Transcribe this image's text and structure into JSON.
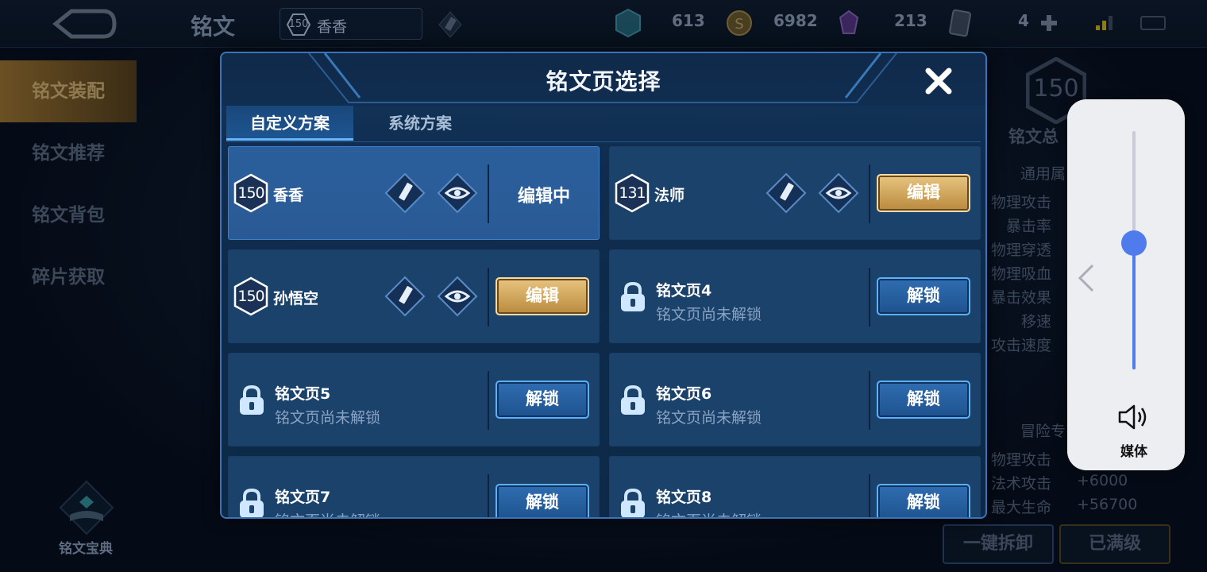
{
  "topbar": {
    "title": "铭文",
    "current_preset": {
      "level": "150",
      "name": "香香"
    },
    "resources": [
      {
        "icon": "blue-gem-icon",
        "value": "613"
      },
      {
        "icon": "gold-coin-icon",
        "value": "6982"
      },
      {
        "icon": "purple-crystal-icon",
        "value": "213"
      },
      {
        "icon": "card-icon",
        "value": "4"
      }
    ]
  },
  "sidebar": {
    "items": [
      "铭文装配",
      "铭文推荐",
      "铭文背包",
      "碎片获取"
    ],
    "active_index": 0,
    "codex_label": "铭文宝典"
  },
  "right_panel": {
    "total_level": "150",
    "total_label": "铭文总",
    "general_label": "通用属",
    "stats": [
      "物理攻击",
      "暴击率",
      "物理穿透",
      "物理吸血",
      "暴击效果",
      "移速",
      "攻击速度"
    ],
    "adventure_label": "冒险专",
    "adv_stats": [
      {
        "name": "物理攻击",
        "value": ""
      },
      {
        "name": "法术攻击",
        "value": "+6000"
      },
      {
        "name": "最大生命",
        "value": "+56700"
      }
    ],
    "unequip_all": "一键拆卸",
    "maxed": "已满级"
  },
  "modal": {
    "title": "铭文页选择",
    "tabs": [
      "自定义方案",
      "系统方案"
    ],
    "active_tab": 0,
    "pages": [
      {
        "level": "150",
        "name": "香香",
        "state": "编辑中",
        "locked": false,
        "active": true
      },
      {
        "level": "131",
        "name": "法师",
        "button": "编辑",
        "locked": false
      },
      {
        "level": "150",
        "name": "孙悟空",
        "button": "编辑",
        "locked": false
      },
      {
        "name": "铭文页4",
        "sub": "铭文页尚未解锁",
        "button": "解锁",
        "locked": true
      },
      {
        "name": "铭文页5",
        "sub": "铭文页尚未解锁",
        "button": "解锁",
        "locked": true
      },
      {
        "name": "铭文页6",
        "sub": "铭文页尚未解锁",
        "button": "解锁",
        "locked": true
      },
      {
        "name": "铭文页7",
        "sub": "铭文页尚未解锁",
        "button": "解锁",
        "locked": true
      },
      {
        "name": "铭文页8",
        "sub": "铭文页尚未解锁",
        "button": "解锁",
        "locked": true
      }
    ]
  },
  "volume": {
    "label": "媒体",
    "level": 0.53,
    "accent": "#4f7bec"
  }
}
